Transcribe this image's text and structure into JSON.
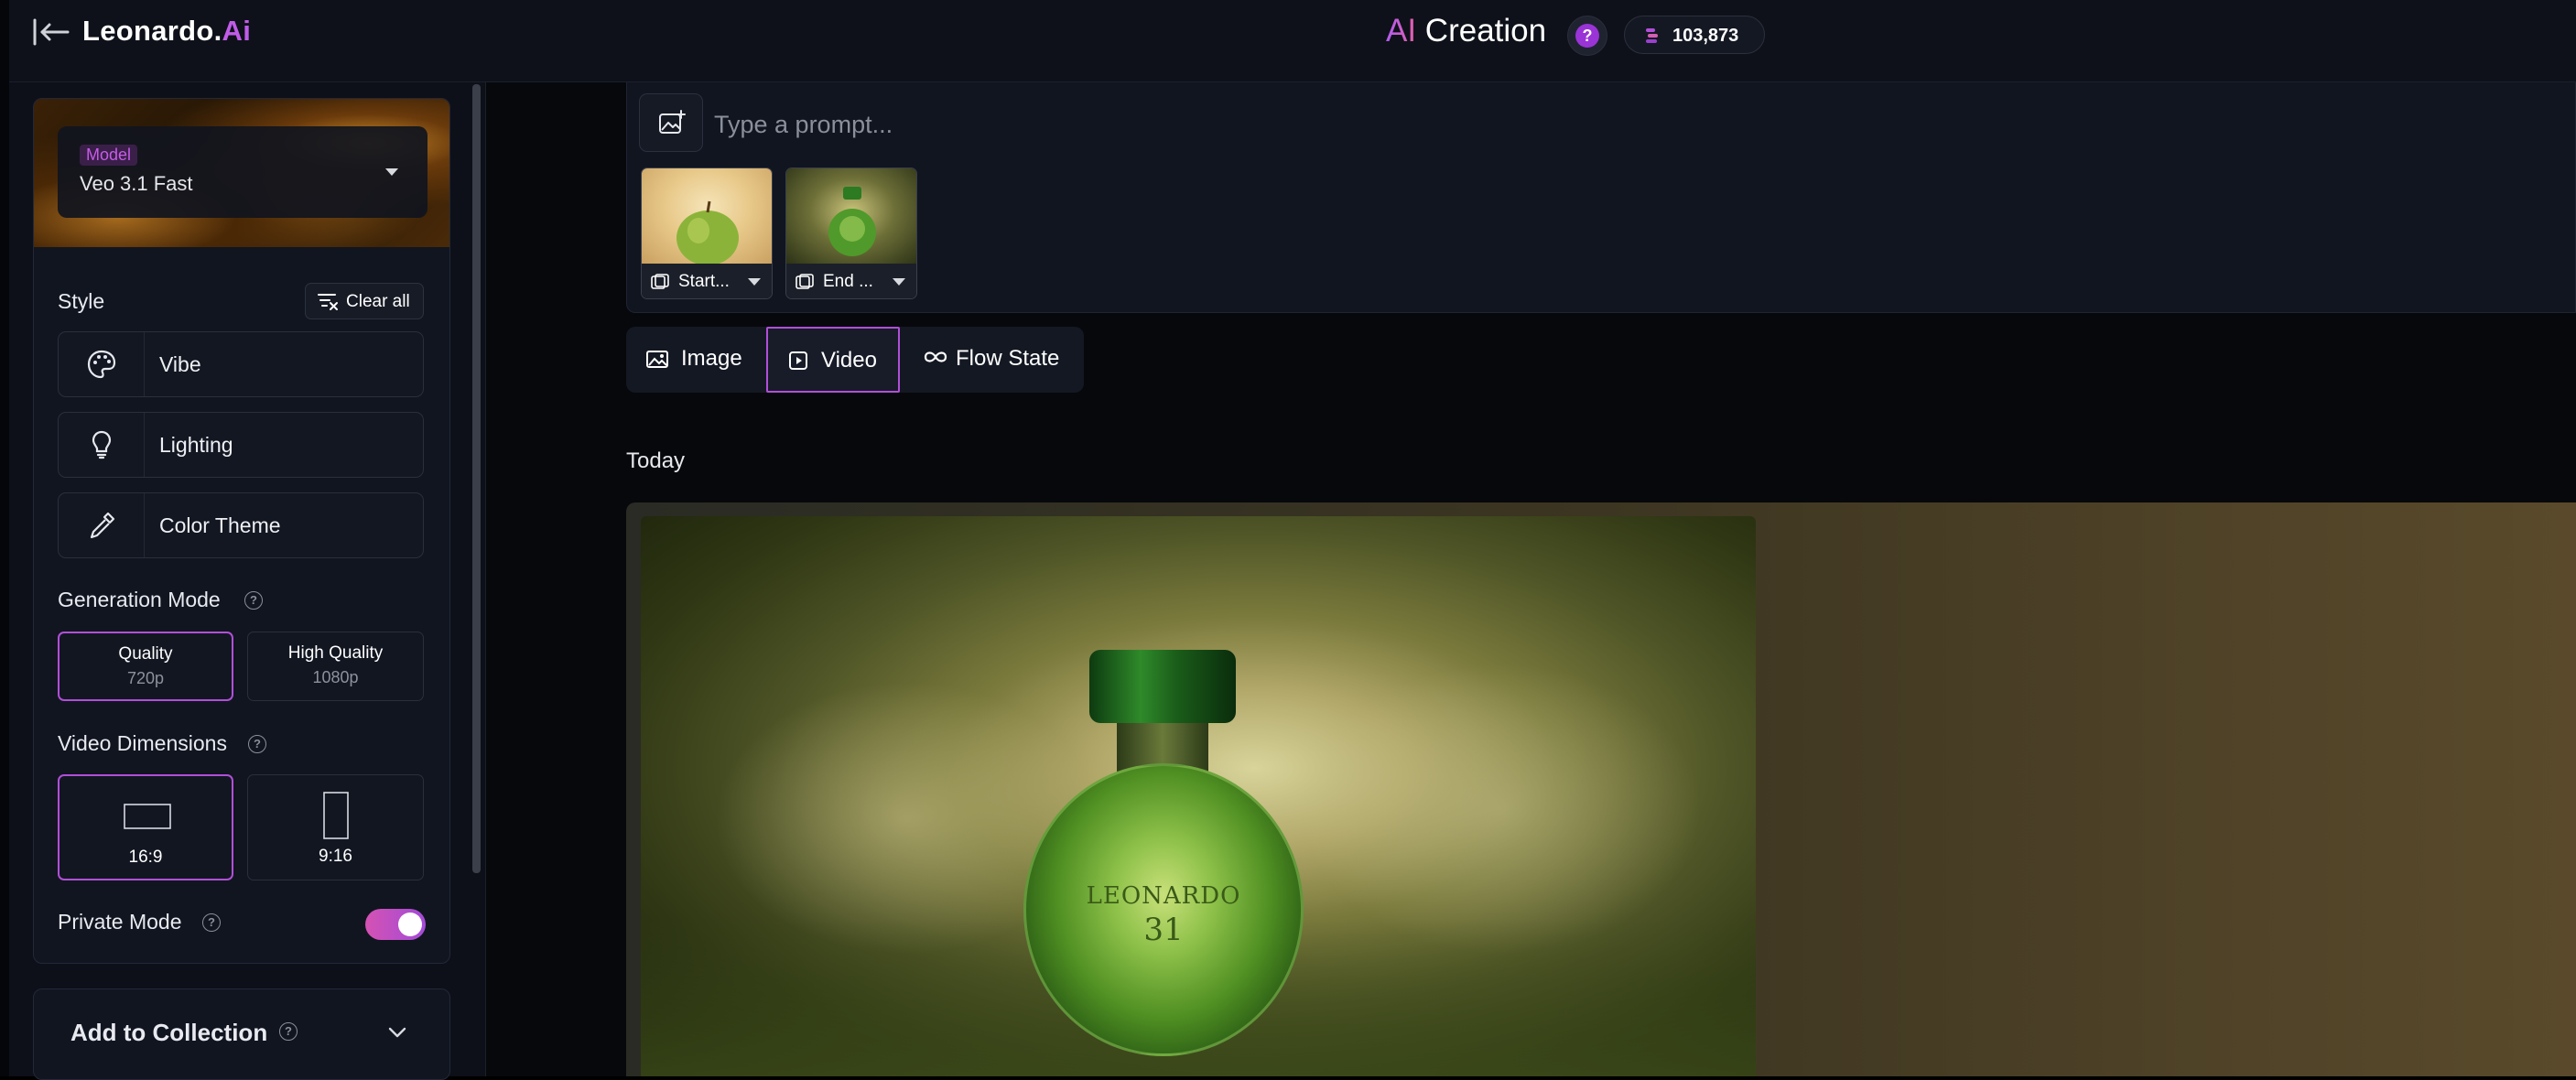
{
  "header": {
    "brand_main": "Leonardo.",
    "brand_ai": "Ai",
    "title_ai": "AI",
    "title_rest": " Creation",
    "help_label": "?",
    "token_count": "103,873"
  },
  "sidebar": {
    "model": {
      "label": "Model",
      "value": "Veo 3.1 Fast"
    },
    "style": {
      "heading": "Style",
      "clear_all": "Clear all",
      "items": [
        {
          "label": "Vibe",
          "icon": "palette-icon"
        },
        {
          "label": "Lighting",
          "icon": "lightbulb-icon"
        },
        {
          "label": "Color Theme",
          "icon": "eyedropper-icon"
        }
      ]
    },
    "generation_mode": {
      "heading": "Generation Mode",
      "options": [
        {
          "title": "Quality",
          "sub": "720p",
          "selected": true
        },
        {
          "title": "High Quality",
          "sub": "1080p",
          "selected": false
        }
      ]
    },
    "video_dimensions": {
      "heading": "Video Dimensions",
      "options": [
        {
          "label": "16:9",
          "selected": true
        },
        {
          "label": "9:16",
          "selected": false
        }
      ]
    },
    "private_mode": {
      "label": "Private Mode",
      "enabled": true
    },
    "add_to_collection": {
      "label": "Add to Collection"
    }
  },
  "prompt": {
    "placeholder": "Type a prompt...",
    "frames": [
      {
        "label": "Start..."
      },
      {
        "label": "End ..."
      }
    ]
  },
  "tabs": [
    {
      "label": "Image",
      "active": false
    },
    {
      "label": "Video",
      "active": true
    },
    {
      "label": "Flow State",
      "active": false
    }
  ],
  "feed": {
    "section_label": "Today",
    "bottle_text_1": "LEONARDO",
    "bottle_text_2": "31"
  },
  "colors": {
    "accent": "#b14fd9",
    "brand_ai": "#c05ce8",
    "background": "#0a0c12"
  }
}
